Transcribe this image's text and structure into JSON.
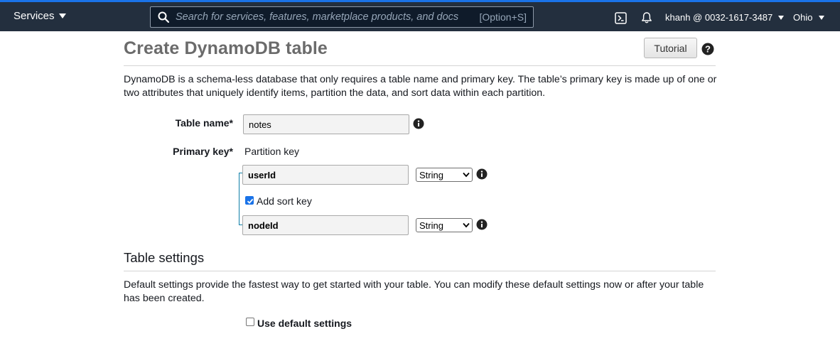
{
  "nav": {
    "services_label": "Services",
    "search_placeholder": "Search for services, features, marketplace products, and docs",
    "search_shortcut": "[Option+S]",
    "account_label": "khanh @ 0032-1617-3487",
    "region_label": "Ohio",
    "icons": [
      "search-icon",
      "cloudshell-icon",
      "bell-icon",
      "caret-down-icon"
    ]
  },
  "page": {
    "title": "Create DynamoDB table",
    "tutorial_button": "Tutorial",
    "description": "DynamoDB is a schema-less database that only requires a table name and primary key. The table’s primary key is made up of one or two attributes that uniquely identify items, partition the data, and sort data within each partition."
  },
  "form": {
    "table_name_label": "Table name*",
    "table_name_value": "notes",
    "primary_key_label": "Primary key*",
    "partition_key_label": "Partition key",
    "partition_key_value": "userId",
    "partition_key_type": "String",
    "add_sort_key_label": "Add sort key",
    "add_sort_key_checked": true,
    "sort_key_value": "nodeId",
    "sort_key_type": "String"
  },
  "table_settings": {
    "title": "Table settings",
    "description": "Default settings provide the fastest way to get started with your table. You can modify these default settings now or after your table has been created.",
    "use_default_label": "Use default settings",
    "use_default_checked": false
  },
  "colors": {
    "nav_bg": "#232f3e",
    "accent": "#1a73e8",
    "title_gray": "#6b6b6b"
  }
}
